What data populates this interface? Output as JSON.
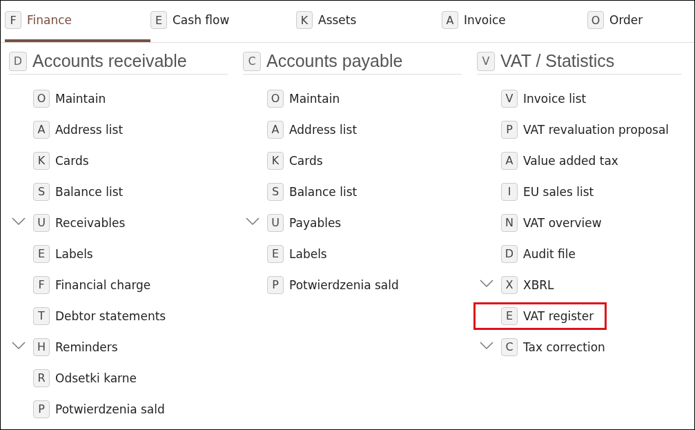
{
  "tabs": [
    {
      "key": "F",
      "label": "Finance",
      "selected": true
    },
    {
      "key": "E",
      "label": "Cash flow",
      "selected": false
    },
    {
      "key": "K",
      "label": "Assets",
      "selected": false
    },
    {
      "key": "A",
      "label": "Invoice",
      "selected": false
    },
    {
      "key": "O",
      "label": "Order",
      "selected": false
    }
  ],
  "columns": [
    {
      "key": "D",
      "title": "Accounts receivable",
      "items": [
        {
          "key": "O",
          "label": "Maintain",
          "kind": "item",
          "highlighted": false
        },
        {
          "key": "A",
          "label": "Address list",
          "kind": "item",
          "highlighted": false
        },
        {
          "key": "K",
          "label": "Cards",
          "kind": "item",
          "highlighted": false
        },
        {
          "key": "S",
          "label": "Balance list",
          "kind": "item",
          "highlighted": false
        },
        {
          "key": "U",
          "label": "Receivables",
          "kind": "group",
          "highlighted": false
        },
        {
          "key": "E",
          "label": "Labels",
          "kind": "item",
          "highlighted": false
        },
        {
          "key": "F",
          "label": "Financial charge",
          "kind": "item",
          "highlighted": false
        },
        {
          "key": "T",
          "label": "Debtor statements",
          "kind": "item",
          "highlighted": false
        },
        {
          "key": "H",
          "label": "Reminders",
          "kind": "group",
          "highlighted": false
        },
        {
          "key": "R",
          "label": "Odsetki karne",
          "kind": "item",
          "highlighted": false
        },
        {
          "key": "P",
          "label": "Potwierdzenia sald",
          "kind": "item",
          "highlighted": false
        }
      ]
    },
    {
      "key": "C",
      "title": "Accounts payable",
      "items": [
        {
          "key": "O",
          "label": "Maintain",
          "kind": "item",
          "highlighted": false
        },
        {
          "key": "A",
          "label": "Address list",
          "kind": "item",
          "highlighted": false
        },
        {
          "key": "K",
          "label": "Cards",
          "kind": "item",
          "highlighted": false
        },
        {
          "key": "S",
          "label": "Balance list",
          "kind": "item",
          "highlighted": false
        },
        {
          "key": "U",
          "label": "Payables",
          "kind": "group",
          "highlighted": false
        },
        {
          "key": "E",
          "label": "Labels",
          "kind": "item",
          "highlighted": false
        },
        {
          "key": "P",
          "label": "Potwierdzenia sald",
          "kind": "item",
          "highlighted": false
        }
      ]
    },
    {
      "key": "V",
      "title": "VAT / Statistics",
      "items": [
        {
          "key": "V",
          "label": "Invoice list",
          "kind": "item",
          "highlighted": false
        },
        {
          "key": "P",
          "label": "VAT revaluation proposal",
          "kind": "item",
          "highlighted": false
        },
        {
          "key": "A",
          "label": "Value added tax",
          "kind": "item",
          "highlighted": false
        },
        {
          "key": "I",
          "label": "EU sales list",
          "kind": "item",
          "highlighted": false
        },
        {
          "key": "N",
          "label": "VAT overview",
          "kind": "item",
          "highlighted": false
        },
        {
          "key": "D",
          "label": "Audit file",
          "kind": "item",
          "highlighted": false
        },
        {
          "key": "X",
          "label": "XBRL",
          "kind": "group",
          "highlighted": false
        },
        {
          "key": "E",
          "label": "VAT register",
          "kind": "item",
          "highlighted": true
        },
        {
          "key": "C",
          "label": "Tax correction",
          "kind": "group",
          "highlighted": false
        }
      ]
    }
  ]
}
